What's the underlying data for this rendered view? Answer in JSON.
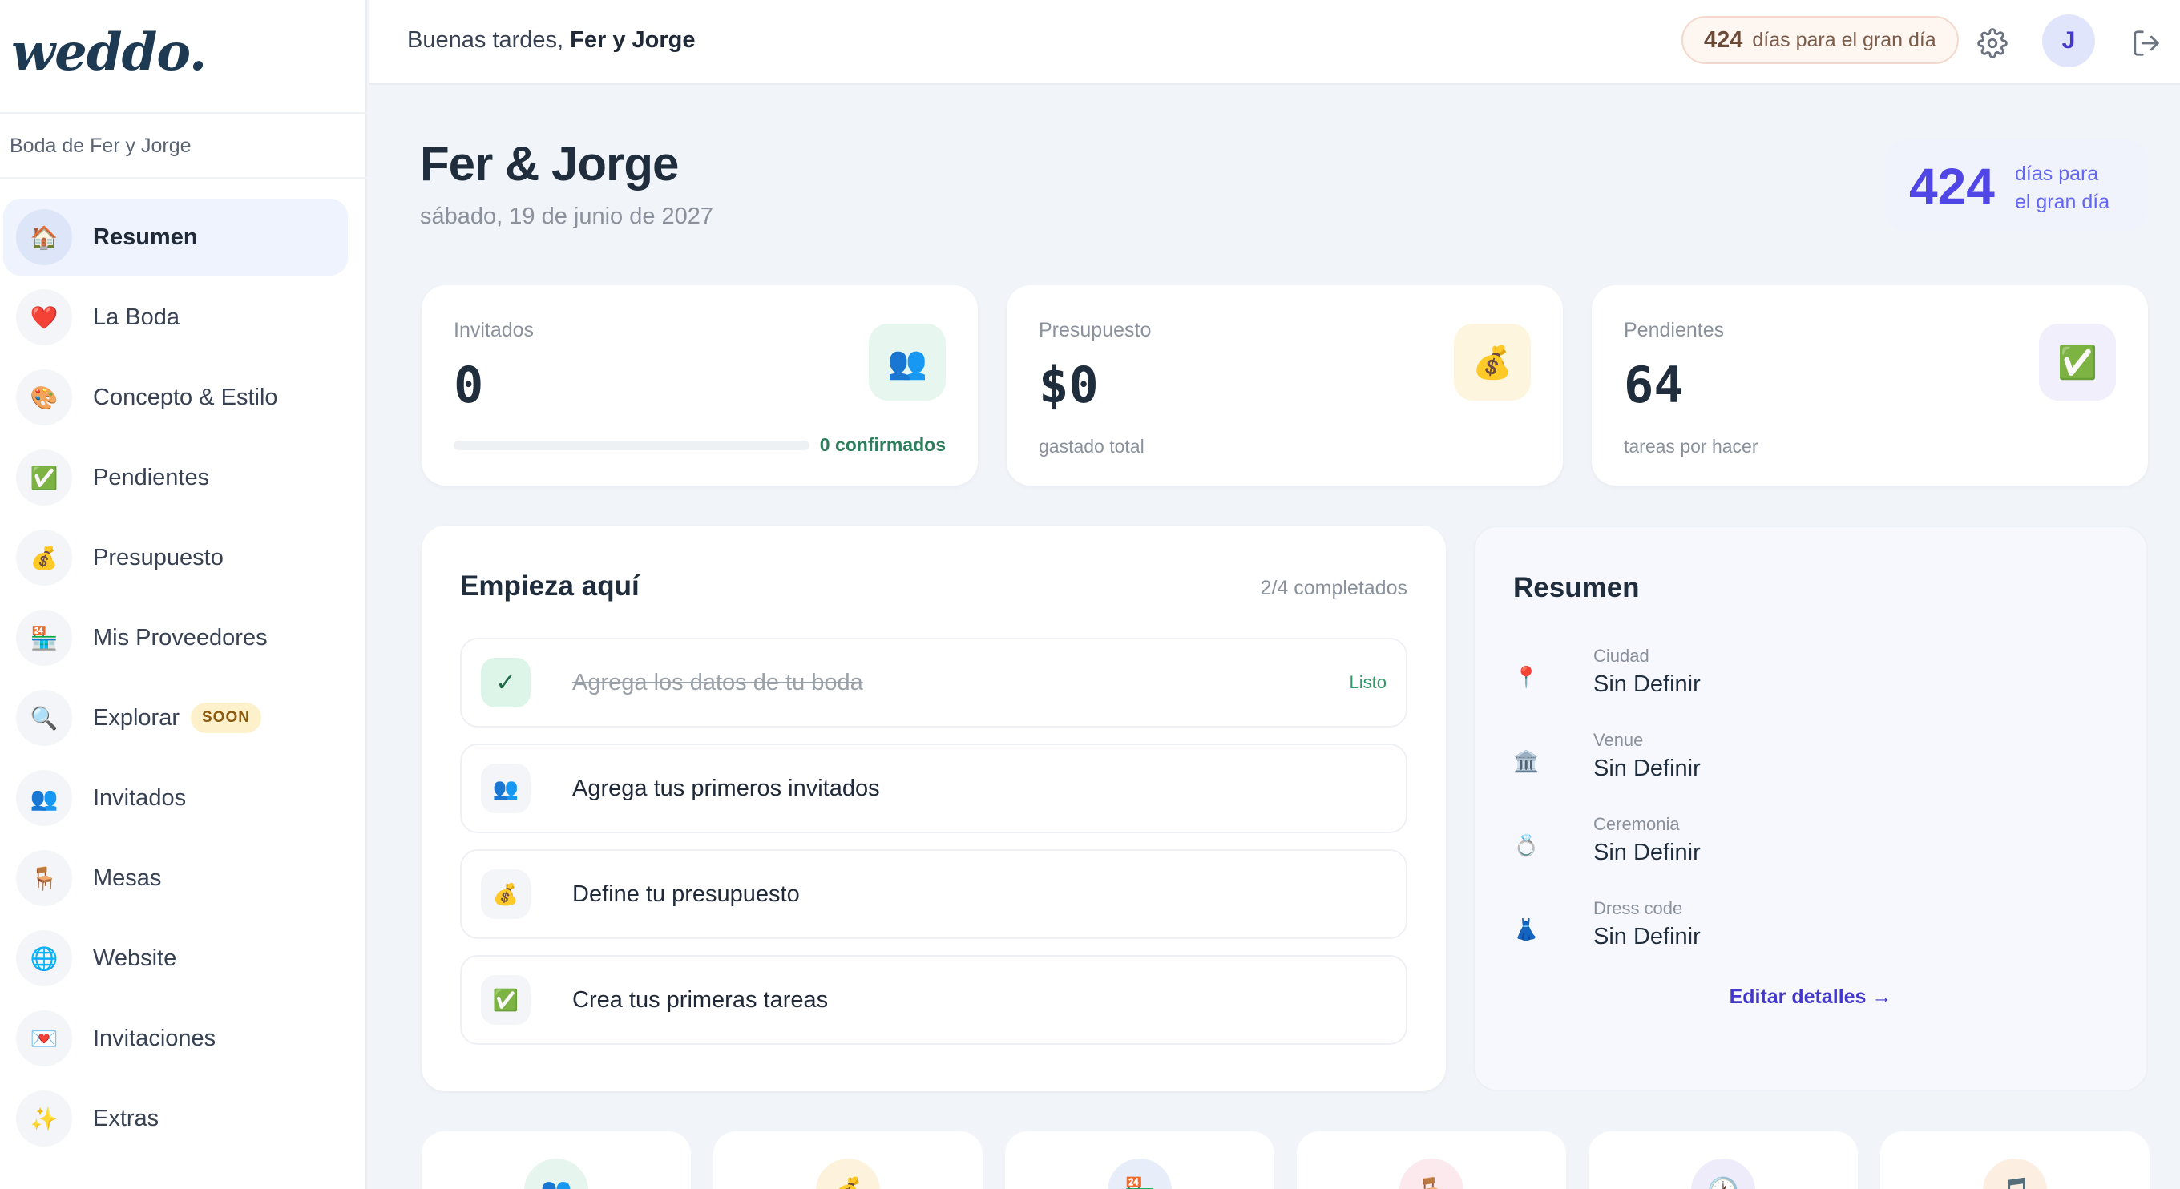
{
  "app": {
    "logo": "weddo.",
    "wedding_name": "Boda de Fer y Jorge"
  },
  "nav": [
    {
      "label": "Resumen",
      "icon": "🏠",
      "icon_name": "home-icon",
      "active": true
    },
    {
      "label": "La Boda",
      "icon": "❤️",
      "icon_name": "heart-icon"
    },
    {
      "label": "Concepto & Estilo",
      "icon": "🎨",
      "icon_name": "palette-icon"
    },
    {
      "label": "Pendientes",
      "icon": "✅",
      "icon_name": "check-icon"
    },
    {
      "label": "Presupuesto",
      "icon": "💰",
      "icon_name": "money-bag-icon"
    },
    {
      "label": "Mis Proveedores",
      "icon": "🏪",
      "icon_name": "store-icon"
    },
    {
      "label": "Explorar",
      "icon": "🔍",
      "icon_name": "search-icon",
      "badge": "SOON"
    },
    {
      "label": "Invitados",
      "icon": "👥",
      "icon_name": "people-icon"
    },
    {
      "label": "Mesas",
      "icon": "🪑",
      "icon_name": "chair-icon"
    },
    {
      "label": "Website",
      "icon": "🌐",
      "icon_name": "globe-icon"
    },
    {
      "label": "Invitaciones",
      "icon": "💌",
      "icon_name": "love-letter-icon"
    },
    {
      "label": "Extras",
      "icon": "✨",
      "icon_name": "sparkles-icon"
    }
  ],
  "topbar": {
    "greeting_prefix": "Buenas tardes,",
    "greeting_names": "Fer y Jorge",
    "countdown_days": "424",
    "countdown_text": "días para el gran día",
    "avatar_initial": "J"
  },
  "header": {
    "title": "Fer & Jorge",
    "date": "sábado, 19 de junio de 2027",
    "days_number": "424",
    "days_line1": "días para",
    "days_line2": "el gran día"
  },
  "stats": {
    "guests": {
      "label": "Invitados",
      "value": "0",
      "confirmed": "0 confirmados",
      "confirmed_fraction": 0,
      "icon": "👥"
    },
    "budget": {
      "label": "Presupuesto",
      "value": "$0",
      "sub": "gastado total",
      "icon": "💰"
    },
    "pending": {
      "label": "Pendientes",
      "value": "64",
      "sub": "tareas por hacer",
      "icon": "✅"
    }
  },
  "start": {
    "title": "Empieza aquí",
    "progress": "2/4 completados",
    "tasks": [
      {
        "label": "Agrega los datos de tu boda",
        "icon": "✓",
        "done": true,
        "status": "Listo"
      },
      {
        "label": "Agrega tus primeros invitados",
        "icon": "👥"
      },
      {
        "label": "Define tu presupuesto",
        "icon": "💰"
      },
      {
        "label": "Crea tus primeras tareas",
        "icon": "✅"
      }
    ]
  },
  "summary": {
    "title": "Resumen",
    "rows": [
      {
        "key": "Ciudad",
        "value": "Sin Definir",
        "icon": "📍"
      },
      {
        "key": "Venue",
        "value": "Sin Definir",
        "icon": "🏛️"
      },
      {
        "key": "Ceremonia",
        "value": "Sin Definir",
        "icon": "💍"
      },
      {
        "key": "Dress code",
        "value": "Sin Definir",
        "icon": "👗"
      }
    ],
    "edit_link": "Editar detalles →"
  },
  "quick_cards": [
    {
      "icon": "👥",
      "icon_name": "people-icon",
      "color": "#e6f6ee"
    },
    {
      "icon": "💰",
      "icon_name": "money-bag-icon",
      "color": "#fdf3dc"
    },
    {
      "icon": "🏪",
      "icon_name": "store-icon",
      "color": "#e7eef9"
    },
    {
      "icon": "🪑",
      "icon_name": "chair-icon",
      "color": "#fbe9ee"
    },
    {
      "icon": "🕐",
      "icon_name": "clock-icon",
      "color": "#eeecfa"
    },
    {
      "icon": "🎵",
      "icon_name": "music-icon",
      "color": "#fcefe2"
    }
  ],
  "colors": {
    "accent": "#4f46e5",
    "success": "#2e9a6a",
    "text": "#1f2d3d"
  }
}
